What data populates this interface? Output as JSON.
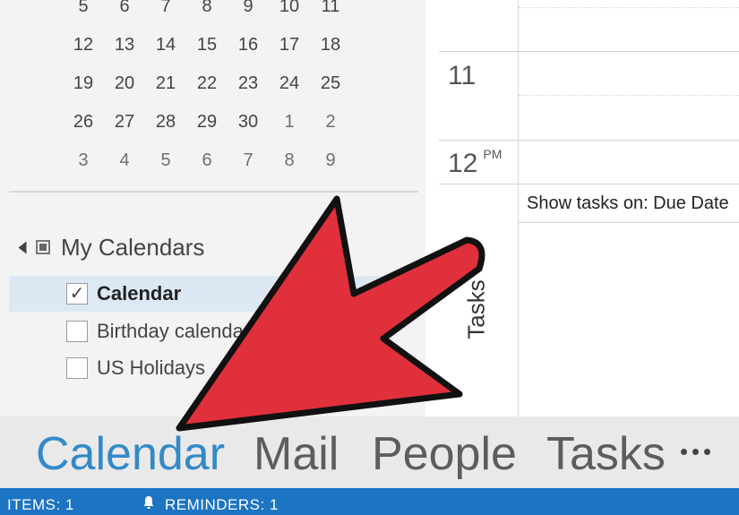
{
  "mini_calendar": {
    "weeks": [
      {
        "days": [
          "5",
          "6",
          "7",
          "8",
          "9",
          "10",
          "11"
        ],
        "muted": []
      },
      {
        "days": [
          "12",
          "13",
          "14",
          "15",
          "16",
          "17",
          "18"
        ],
        "muted": []
      },
      {
        "days": [
          "19",
          "20",
          "21",
          "22",
          "23",
          "24",
          "25"
        ],
        "muted": []
      },
      {
        "days": [
          "26",
          "27",
          "28",
          "29",
          "30",
          "1",
          "2"
        ],
        "muted": [
          5,
          6
        ]
      },
      {
        "days": [
          "3",
          "4",
          "5",
          "6",
          "7",
          "8",
          "9"
        ],
        "muted": [
          0,
          1,
          2,
          3,
          4,
          5,
          6
        ]
      }
    ]
  },
  "calendars": {
    "group_label": "My Calendars",
    "items": [
      {
        "label": "Calendar",
        "checked": true,
        "selected": true
      },
      {
        "label": "Birthday calendar",
        "checked": false,
        "selected": false
      },
      {
        "label": "US Holidays",
        "checked": false,
        "selected": false
      }
    ],
    "check_mark": "✓"
  },
  "day_view": {
    "hour_11": "11",
    "hour_12": "12",
    "hour_12_suffix": "PM",
    "show_tasks_label": "Show tasks on: Due Date",
    "tasks_label": "Tasks"
  },
  "nav": {
    "calendar": "Calendar",
    "mail": "Mail",
    "people": "People",
    "tasks": "Tasks",
    "more_icon": "more-dots-icon"
  },
  "status_bar": {
    "items": "ITEMS: 1",
    "reminders": "REMINDERS: 1"
  },
  "colors": {
    "accent": "#3389c8",
    "status_bar": "#1c74c3",
    "arrow": "#e0303c"
  }
}
